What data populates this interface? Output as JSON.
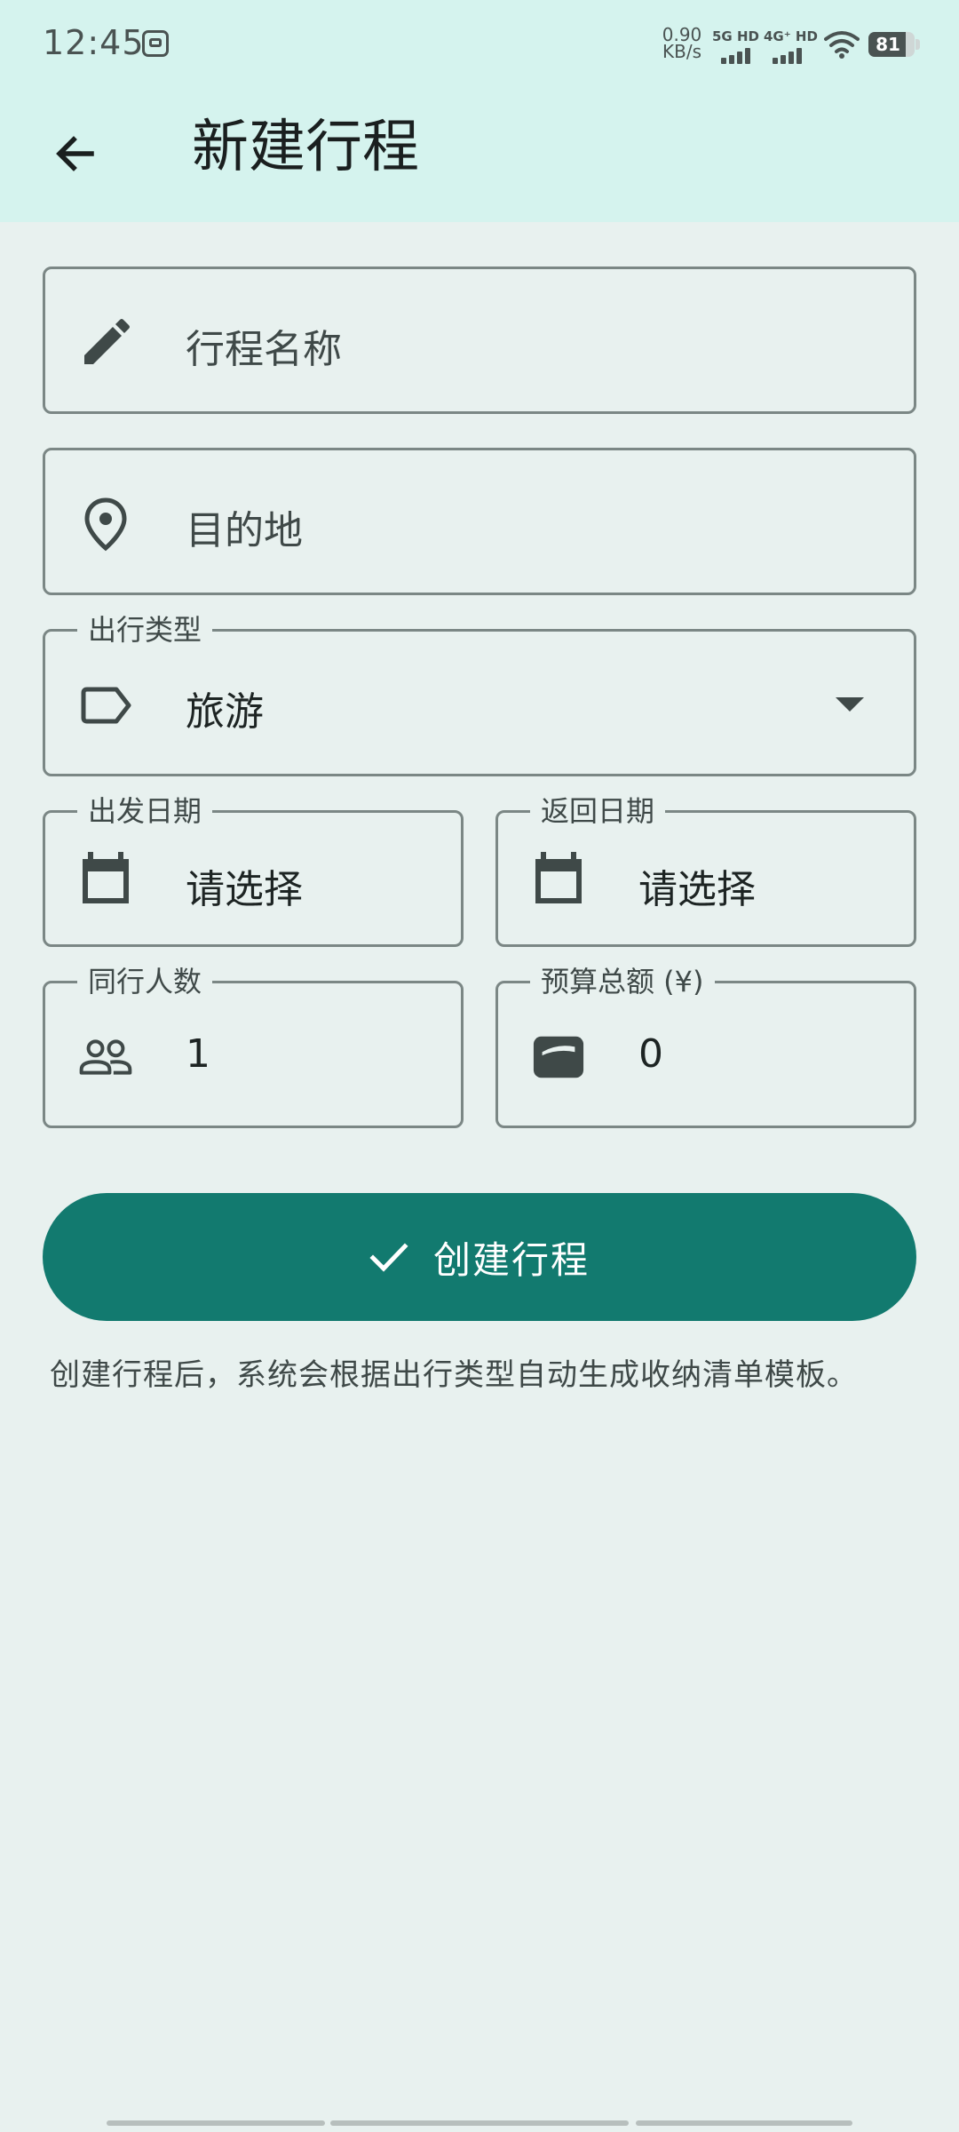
{
  "status_bar": {
    "time": "12:45",
    "net_speed_value": "0.90",
    "net_speed_unit": "KB/s",
    "signal_1_label": "5G HD",
    "signal_2_label": "4G⁺ HD",
    "battery": "81",
    "battery_level": 0.81
  },
  "header": {
    "title": "新建行程"
  },
  "form": {
    "trip_name": {
      "placeholder": "行程名称",
      "icon": "pencil-icon"
    },
    "destination": {
      "placeholder": "目的地",
      "icon": "location-pin-icon"
    },
    "trip_type": {
      "label": "出行类型",
      "value": "旅游",
      "icon": "label-tag-icon"
    },
    "depart_date": {
      "label": "出发日期",
      "value": "请选择",
      "icon": "calendar-icon"
    },
    "return_date": {
      "label": "返回日期",
      "value": "请选择",
      "icon": "calendar-icon"
    },
    "companions": {
      "label": "同行人数",
      "value": "1",
      "icon": "people-icon"
    },
    "budget": {
      "label": "预算总额 (¥)",
      "value": "0",
      "icon": "wallet-icon"
    }
  },
  "actions": {
    "create_label": "创建行程",
    "create_icon": "check-icon"
  },
  "hint": "创建行程后，系统会根据出行类型自动生成收纳清单模板。",
  "colors": {
    "header_bg": "#d5f3ee",
    "page_bg": "#e8f1ef",
    "primary": "#127a6f",
    "outline": "#7b8785"
  }
}
